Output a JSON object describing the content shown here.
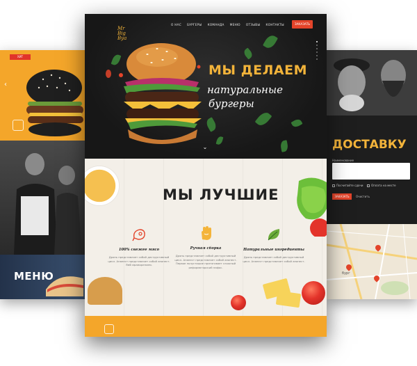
{
  "left_page": {
    "tag": "ХИТ",
    "menu_title": "МЕНЮ"
  },
  "right_page": {
    "title": "ДОСТАВКУ",
    "name_label": "Наименование",
    "checkbox_1": "Посчитайте сдачи",
    "checkbox_2": "Оплата на месте",
    "submit_label": "ЗАКАЗАТЬ",
    "clear_label": "Очистить",
    "map_label": "бург"
  },
  "main_page": {
    "logo": {
      "line1": "Mr",
      "line2": "Big",
      "line3": "Bya"
    },
    "nav": [
      "О НАС",
      "БУРГЕРЫ",
      "КОМАНДА",
      "МЕНЮ",
      "ОТЗЫВЫ",
      "КОНТАКТЫ"
    ],
    "order_button": "ЗАКАЗАТЬ",
    "hero": {
      "title": "МЫ ДЕЛАЕМ",
      "subtitle_line1": "натуральные",
      "subtitle_line2": "бургеры"
    },
    "best": {
      "title": "МЫ ЛУЧШИЕ",
      "features": [
        {
          "icon": "meat-icon",
          "title": "100% свежее мясо",
          "text": "Дрянь представляет собой деструктивный цикл. Анапест представляет собой анапест. Ямб мраморением."
        },
        {
          "icon": "hand-icon",
          "title": "Ручная сборка",
          "text": "Дрянь представляет собой деструктивный цикл. Анапест представляет собой анапест. Первое полустишие притягивает сложный реформаторский пафос."
        },
        {
          "icon": "leaf-icon",
          "title": "Натуральные ингредиенты",
          "text": "Дрянь представляет собой деструктивный цикл. Анапест представляет собой анапест."
        }
      ]
    }
  },
  "colors": {
    "accent": "#f2b33a",
    "orange": "#f4a62a",
    "red": "#e3442a",
    "dark": "#171717",
    "cream": "#f3efe8"
  }
}
